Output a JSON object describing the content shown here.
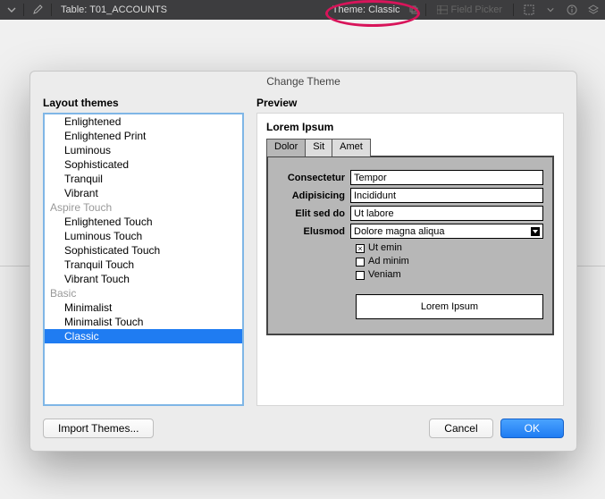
{
  "topbar": {
    "table_label": "Table: T01_ACCOUNTS",
    "theme_label": "Theme: Classic",
    "field_picker_label": "Field Picker"
  },
  "dialog": {
    "title": "Change Theme",
    "layout_label": "Layout themes",
    "preview_label": "Preview",
    "import_label": "Import Themes...",
    "cancel_label": "Cancel",
    "ok_label": "OK",
    "groups": [
      {
        "name": "",
        "items": [
          "Enlightened",
          "Enlightened Print",
          "Luminous",
          "Sophisticated",
          "Tranquil",
          "Vibrant"
        ]
      },
      {
        "name": "Aspire Touch",
        "items": [
          "Enlightened Touch",
          "Luminous Touch",
          "Sophisticated Touch",
          "Tranquil Touch",
          "Vibrant Touch"
        ]
      },
      {
        "name": "Basic",
        "items": [
          "Minimalist",
          "Minimalist Touch",
          "Classic"
        ]
      }
    ],
    "selected": "Classic"
  },
  "preview": {
    "heading": "Lorem Ipsum",
    "tabs": [
      "Dolor",
      "Sit",
      "Amet"
    ],
    "active_tab": 0,
    "rows": [
      {
        "label": "Consectetur",
        "value": "Tempor",
        "type": "text"
      },
      {
        "label": "Adipisicing",
        "value": "Incididunt",
        "type": "text"
      },
      {
        "label": "Elit sed do",
        "value": "Ut labore",
        "type": "text"
      },
      {
        "label": "Elusmod",
        "value": "Dolore magna aliqua",
        "type": "select"
      }
    ],
    "checks": [
      {
        "label": "Ut emin",
        "checked": true
      },
      {
        "label": "Ad minim",
        "checked": false
      },
      {
        "label": "Veniam",
        "checked": false
      }
    ],
    "button_label": "Lorem Ipsum"
  }
}
